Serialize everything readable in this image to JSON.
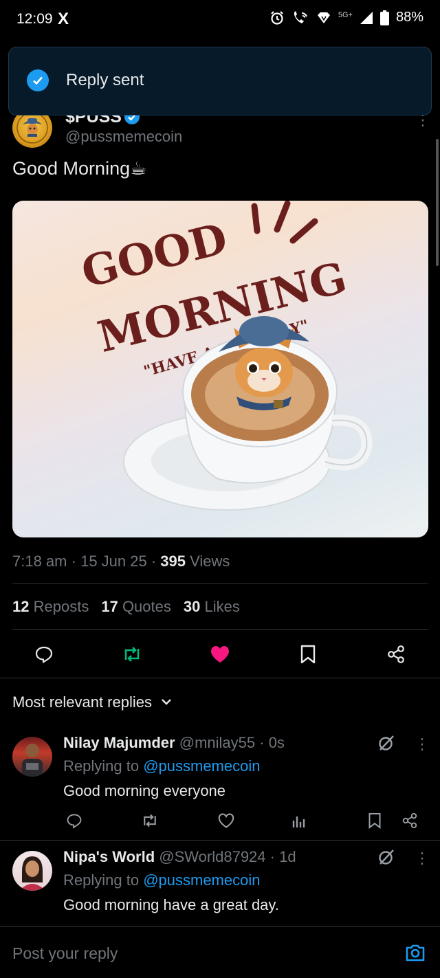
{
  "status_bar": {
    "time": "12:09",
    "app_glyph": "X",
    "network": "5G+",
    "battery": "88%",
    "icons": [
      "alarm-icon",
      "wifi-call-icon",
      "signal-icon",
      "battery-icon"
    ]
  },
  "toast": {
    "message": "Reply sent"
  },
  "tweet": {
    "author_name": "$PUSS",
    "author_handle": "@pussmemecoin",
    "text": "Good Morning☕",
    "image": {
      "line1": "GOOD",
      "line2": "MORNING",
      "line3": "\"HAVE A NICE DAY\""
    },
    "meta": {
      "time": "7:18 am",
      "date": "15 Jun 25",
      "views_count": "395",
      "views_label": "Views",
      "sep": "·"
    },
    "stats": {
      "reposts_count": "12",
      "reposts_label": "Reposts",
      "quotes_count": "17",
      "quotes_label": "Quotes",
      "likes_count": "30",
      "likes_label": "Likes"
    }
  },
  "replies_header": {
    "label": "Most relevant replies"
  },
  "replies": [
    {
      "name": "Nilay Majumder",
      "handle": "@mnilay55",
      "time": "0s",
      "replying_prefix": "Replying to ",
      "replying_to": "@pussmemecoin",
      "text": "Good morning everyone"
    },
    {
      "name": "Nipa's World",
      "handle": "@SWorld87924",
      "time": "1d",
      "replying_prefix": "Replying to ",
      "replying_to": "@pussmemecoin",
      "text": "Good morning have a great day."
    }
  ],
  "composer": {
    "placeholder": "Post your reply"
  },
  "colors": {
    "accent": "#1d9bf0",
    "like": "#f91880",
    "repost": "#00ba7c",
    "muted": "#71767b",
    "toast_bg": "#061a2a"
  }
}
